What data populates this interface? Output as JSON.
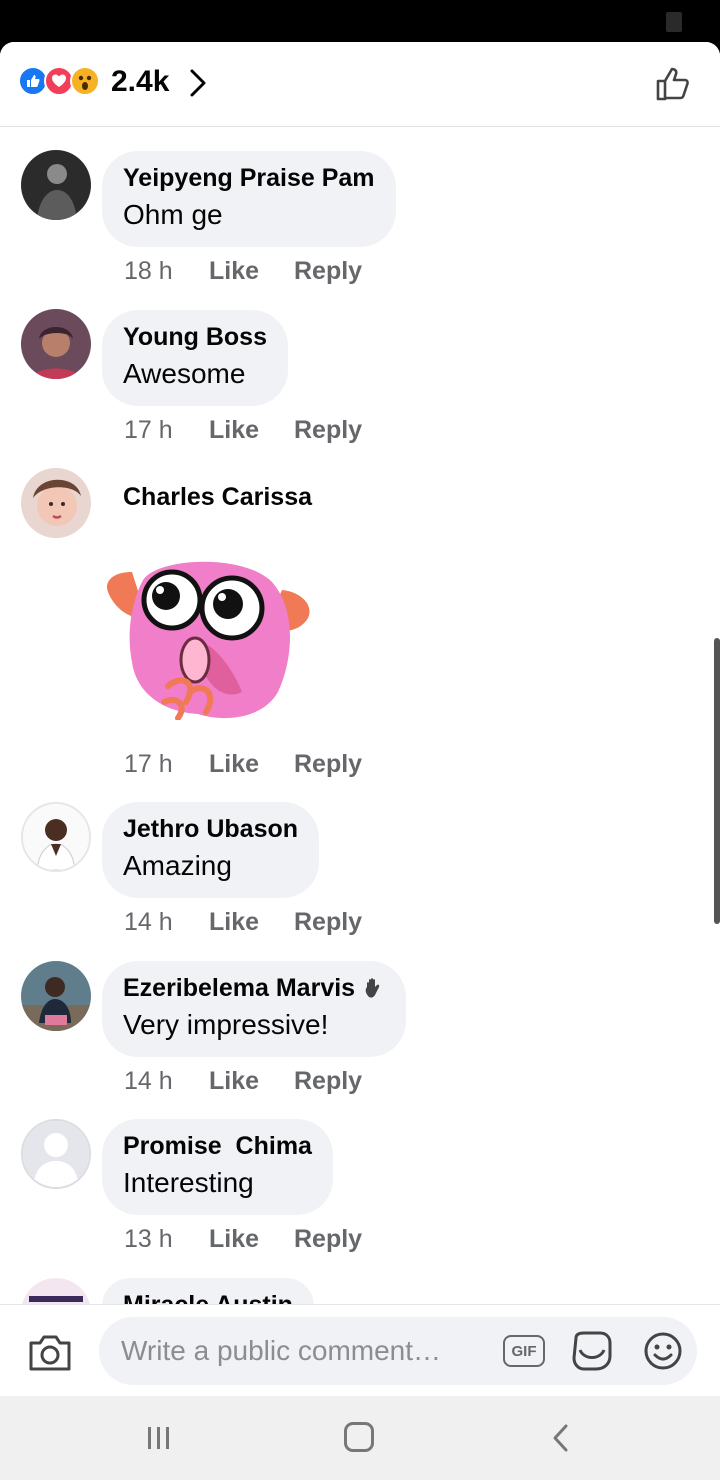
{
  "reactions": {
    "icons": [
      "like-reaction",
      "love-reaction",
      "wow-reaction"
    ],
    "count": "2.4k"
  },
  "comments": [
    {
      "author": "Yeipyeng Praise Pam",
      "text": "Ohm ge",
      "time": "18 h",
      "like": "Like",
      "reply": "Reply"
    },
    {
      "author": "Young Boss",
      "text": "Awesome",
      "time": "17 h",
      "like": "Like",
      "reply": "Reply"
    },
    {
      "author": "Charles Carissa",
      "text": "",
      "time": "17 h",
      "like": "Like",
      "reply": "Reply",
      "sticker": "surprised-pink-creature"
    },
    {
      "author": "Jethro Ubason",
      "text": "Amazing",
      "time": "14 h",
      "like": "Like",
      "reply": "Reply"
    },
    {
      "author": "Ezeribelema Marvis",
      "text": "Very impressive!",
      "time": "14 h",
      "like": "Like",
      "reply": "Reply",
      "badge": "wave-hand-icon"
    },
    {
      "author": "Promise  Chima",
      "text": "Interesting",
      "time": "13 h",
      "like": "Like",
      "reply": "Reply"
    },
    {
      "author": "Miracle Austin",
      "text": "",
      "time": "",
      "like": "",
      "reply": ""
    }
  ],
  "composer": {
    "placeholder": "Write a public comment…",
    "gif_label": "GIF"
  },
  "colors": {
    "like_blue": "#1877f2",
    "love_red": "#f33e58",
    "wow_yellow": "#f7b125",
    "bubble_bg": "#f0f2f5",
    "meta_gray": "#65676b"
  }
}
